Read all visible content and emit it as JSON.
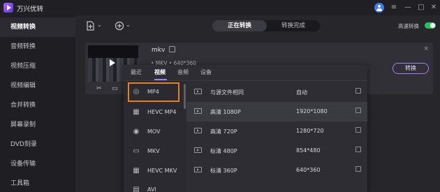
{
  "app": {
    "title": "万兴优转"
  },
  "window": {
    "menu_glyph": "≡",
    "minimize_glyph": "—",
    "maximize_glyph": "□",
    "close_glyph": "✕"
  },
  "sidebar": {
    "items": [
      {
        "label": "视频转换",
        "active": true
      },
      {
        "label": "音频转换"
      },
      {
        "label": "视频压缩"
      },
      {
        "label": "视频编辑"
      },
      {
        "label": "合并转换"
      },
      {
        "label": "屏幕录制"
      },
      {
        "label": "DVD刻录"
      },
      {
        "label": "设备传输"
      },
      {
        "label": "工具箱"
      }
    ]
  },
  "toolbar": {
    "add_file_icon": "add-file-icon",
    "add_media_icon": "add-media-icon",
    "dropdown_glyph": "⌄",
    "tabs": [
      {
        "label": "正在转换",
        "active": true
      },
      {
        "label": "转换完成"
      }
    ],
    "fast_convert_label": "高速转换",
    "fast_convert_on": true,
    "accent": "#27c25a"
  },
  "file_card": {
    "name": "mkv",
    "meta": "• MKV  •  640*360",
    "convert_label": "转换",
    "close_glyph": "×",
    "tool_glyphs": {
      "cut": "✂",
      "crop": "▭",
      "effect": "⋯"
    }
  },
  "dropdown": {
    "tabs": [
      {
        "label": "最近"
      },
      {
        "label": "视频",
        "active": true
      },
      {
        "label": "音频"
      },
      {
        "label": "设备"
      }
    ],
    "formats": [
      {
        "label": "MP4",
        "icon": "mp4-icon",
        "selected": true
      },
      {
        "label": "HEVC MP4",
        "icon": "hevc-mp4-icon"
      },
      {
        "label": "MOV",
        "icon": "mov-icon"
      },
      {
        "label": "MKV",
        "icon": "mkv-icon"
      },
      {
        "label": "HEVC MKV",
        "icon": "hevc-mkv-icon"
      },
      {
        "label": "AVI",
        "icon": "avi-icon"
      }
    ],
    "resolutions": [
      {
        "name": "与源文件相同",
        "value": "自动"
      },
      {
        "name": "高清 1080P",
        "value": "1920*1080",
        "highlighted": true
      },
      {
        "name": "高清 720P",
        "value": "1280*720"
      },
      {
        "name": "标清 480P",
        "value": "854*480"
      },
      {
        "name": "标清 360P",
        "value": "640*360"
      }
    ],
    "selection_color": "#e67e22",
    "tab_accent": "#a77cff"
  }
}
